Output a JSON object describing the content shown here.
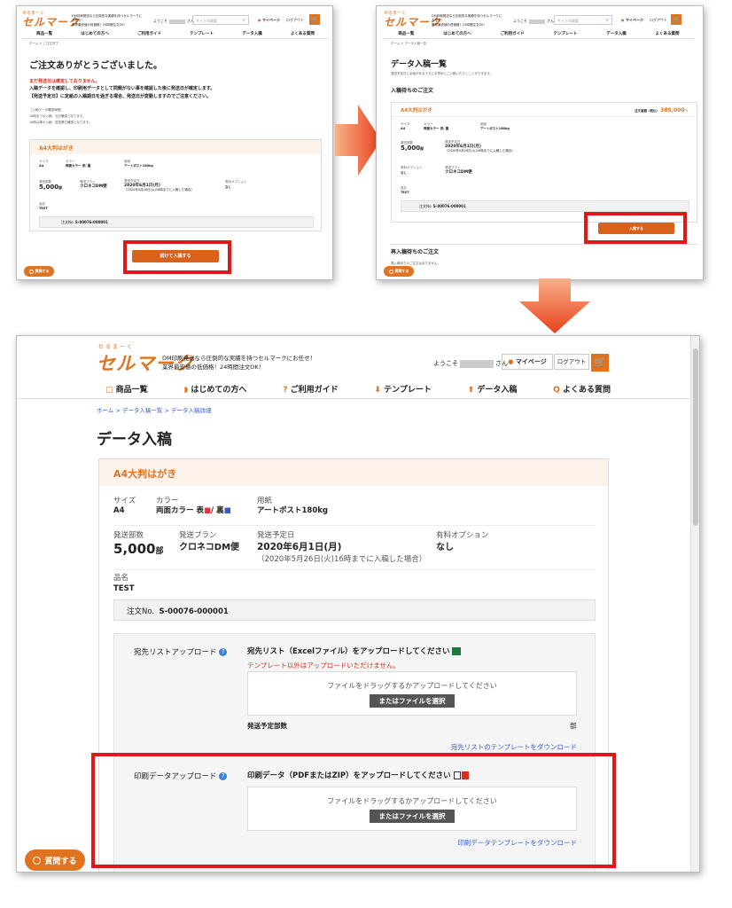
{
  "header": {
    "logo_kana": "せるまーく",
    "logo": "セルマーク",
    "tagline1": "DM印刷発送なら圧倒的な実績を持つセルマークにお任せ！",
    "tagline2": "業界最安値の低価格！24時間注文OK！",
    "welcome_prefix": "ようこそ",
    "welcome_suffix": "さん",
    "search_placeholder": "サイト内検索",
    "mypage": "マイページ",
    "logout": "ログアウト"
  },
  "nav": {
    "items": [
      "商品一覧",
      "はじめての方へ",
      "ご利用ガイド",
      "テンプレート",
      "データ入稿",
      "よくある質問"
    ]
  },
  "shot1": {
    "breadcrumb": "ホーム > ご注文完了",
    "title": "ご注文ありがとうございました。",
    "notice_red": "まだ発送日は確定しておりません。",
    "notice1": "入稿データを確認し、印刷用データとして問題がない事を確認した後に発送日が確定します。",
    "notice2": "【発送予定日】に定紙の入稿期日を過ぎる場合、発送日が変動しますのでご注意ください。",
    "small1": "［入稿データ確認時間］",
    "small2": "16時までの入稿：当日確認となります。",
    "small3": "16時以降の入稿：翌営業日確認となります。",
    "button": "続けて入稿する"
  },
  "shot2": {
    "breadcrumb": "ホーム > データ入稿一覧",
    "title": "データ入稿一覧",
    "desc": "発送予定日に余裕があるうちにお早めにご入稿いただくことができます。",
    "section1": "入稿待ちのご注文",
    "total_label": "注文金額（税込）",
    "total_value": "385,000",
    "total_unit": "円",
    "button": "入稿する",
    "section2": "再入稿待ちのご注文",
    "section2_desc": "再入稿待ちのご注文はありません。"
  },
  "order": {
    "product": "A4大判はがき",
    "size_label": "サイズ",
    "size": "A4",
    "color_label": "カラー",
    "color": "両面カラー 表",
    "color_back": "/ 裏",
    "paper_label": "用紙",
    "paper": "アートポスト180kg",
    "qty_label": "発送部数",
    "qty": "5,000",
    "qty_unit": "部",
    "plan_label": "発送プラン",
    "plan": "クロネコDM便",
    "date_label": "発送予定日",
    "date": "2020年6月1日(月)",
    "date_note": "（2020年5月26日(火)16時までに入稿した場合）",
    "option_label": "有料オプション",
    "option": "なし",
    "name_label": "品名",
    "name": "TEST",
    "order_no_label": "注文No.",
    "order_no": "S-00076-000001"
  },
  "main": {
    "breadcrumb": "ホーム > データ入稿一覧 > データ入稿詳細",
    "title": "データ入稿",
    "list_upload_label": "宛先リストアップロード",
    "list_upload_title": "宛先リスト（Excelファイル）をアップロードしてください",
    "list_upload_warn": "テンプレート以外はアップロードいただけません。",
    "drop_text": "ファイルをドラッグするかアップロードしてください",
    "choose_file": "またはファイルを選択",
    "qty_planned": "発送予定部数",
    "qty_planned_unit": "部",
    "list_template_link": "宛先リストのテンプレートをダウンロード",
    "print_upload_label": "印刷データアップロード",
    "print_upload_title": "印刷データ（PDFまたはZIP）をアップロードしてください",
    "print_template_link": "印刷データテンプレートをダウンロード",
    "ask_button": "質問する"
  },
  "colors": {
    "accent": "#e0731f",
    "button": "#d9621b",
    "highlight": "#e01818",
    "link": "#3a5fcd",
    "warn": "#d62e1f"
  }
}
